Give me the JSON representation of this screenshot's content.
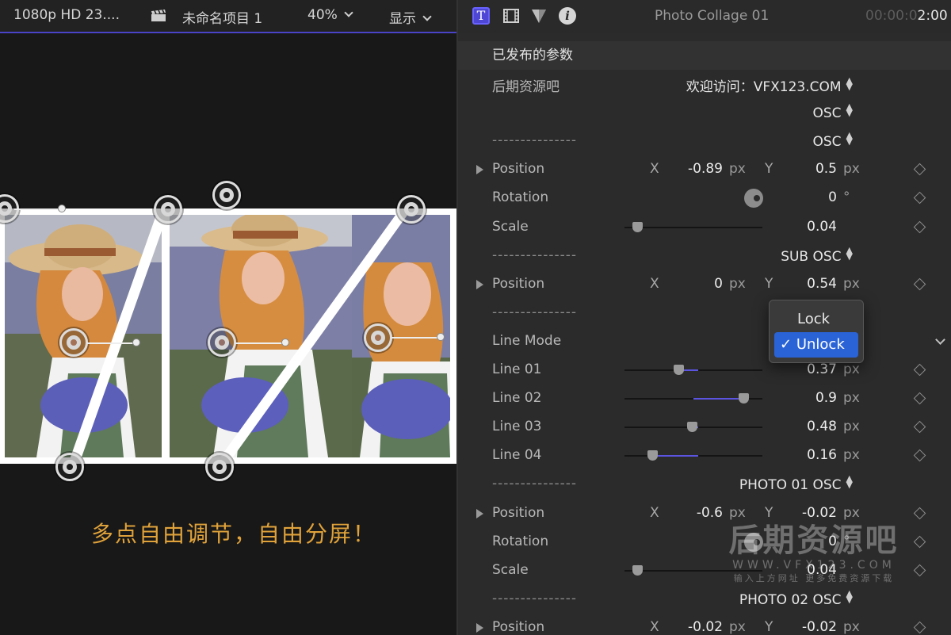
{
  "viewer": {
    "format": "1080p HD 23....",
    "project_name": "未命名项目 1",
    "zoom": "40%",
    "display_menu": "显示",
    "caption": "多点自由调节，自由分屏！"
  },
  "inspector": {
    "title": "Photo Collage 01",
    "timecode_dim": "00:00:0",
    "timecode": "2:00",
    "section_title": "已发布的参数",
    "rows": [
      {
        "label": "后期资源吧",
        "popup": "欢迎访问：VFX123.COM"
      },
      {
        "label": "",
        "popup": "OSC"
      },
      {
        "label": "---------------",
        "popup": "OSC"
      },
      {
        "label": "Position",
        "x_axis": "X",
        "x_value": "-0.89",
        "x_unit": "px",
        "y_axis": "Y",
        "y_value": "0.5",
        "y_unit": "px"
      },
      {
        "label": "Rotation",
        "value": "0",
        "unit": "°"
      },
      {
        "label": "Scale",
        "value": "0.04",
        "slider": 0.04
      },
      {
        "label": "---------------",
        "popup": "SUB OSC"
      },
      {
        "label": "Position",
        "x_axis": "X",
        "x_value": "0",
        "x_unit": "px",
        "y_axis": "Y",
        "y_value": "0.54",
        "y_unit": "px"
      },
      {
        "label": "---------------"
      },
      {
        "label": "Line Mode"
      },
      {
        "label": "Line 01",
        "value": "0.37",
        "unit": "px",
        "slider": 0.37
      },
      {
        "label": "Line 02",
        "value": "0.9",
        "unit": "px",
        "slider": 0.9
      },
      {
        "label": "Line 03",
        "value": "0.48",
        "unit": "px",
        "slider": 0.48
      },
      {
        "label": "Line 04",
        "value": "0.16",
        "unit": "px",
        "slider": 0.16
      },
      {
        "label": "---------------",
        "popup": "PHOTO 01 OSC"
      },
      {
        "label": "Position",
        "x_axis": "X",
        "x_value": "-0.6",
        "x_unit": "px",
        "y_axis": "Y",
        "y_value": "-0.02",
        "y_unit": "px"
      },
      {
        "label": "Rotation",
        "value": "0",
        "unit": "°"
      },
      {
        "label": "Scale",
        "value": "0.04",
        "slider": 0.04
      },
      {
        "label": "---------------",
        "popup": "PHOTO 02 OSC"
      },
      {
        "label": "Position",
        "x_axis": "X",
        "x_value": "-0.02",
        "x_unit": "px",
        "y_axis": "Y",
        "y_value": "-0.02",
        "y_unit": "px"
      }
    ],
    "line_mode_menu": {
      "options": [
        "Lock",
        "Unlock"
      ],
      "selected": "Unlock",
      "check": "✓"
    }
  },
  "watermark": {
    "title": "后期资源吧",
    "url": "WWW.VFX123.COM",
    "subtitle": "输入上方网址 更多免费资源下载"
  },
  "colors": {
    "accent": "#4e47d6",
    "caption": "#e0a23a",
    "menu_highlight": "#2a63d6"
  },
  "icons": [
    "clapper-icon",
    "text-inspector-icon",
    "film-inspector-icon",
    "color-inspector-icon",
    "info-icon",
    "disclosure-triangle-icon",
    "keyframe-diamond-icon",
    "rotation-dial-icon",
    "popup-arrows-icon",
    "chevron-down-icon",
    "checkmark-icon"
  ]
}
